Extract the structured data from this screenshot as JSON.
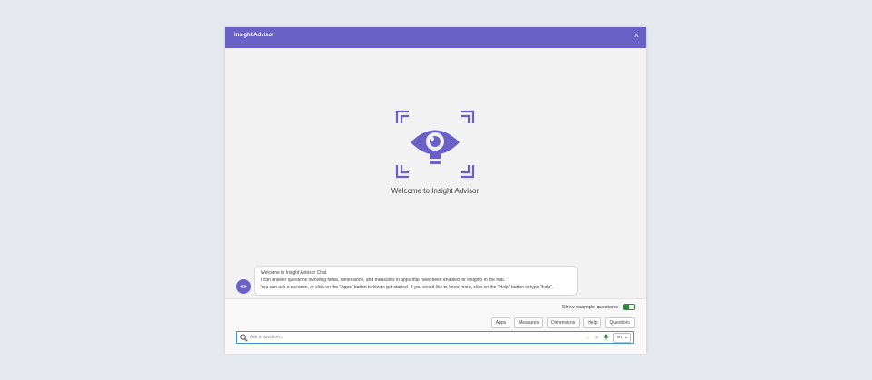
{
  "dialog": {
    "title": "Insight Advisor",
    "close_glyph": "×",
    "accent_color": "#6a60c5",
    "hero_icon": "eye-lightbulb-icon",
    "welcome_title": "Welcome to Insight Advisor"
  },
  "chat": {
    "avatar_icon": "insight-advisor-eye-icon",
    "message_lines": [
      "Welcome to Insight Advisor Chat.",
      "I can answer questions involving fields, dimensions, and measures in apps that have been enabled for insights in the hub.",
      "You can ask a question, or click on the \"Apps\" button below to get started. If you would like to know more, click on the \"Help\" button or type \"help\"."
    ]
  },
  "footer": {
    "show_examples_label": "Show example questions",
    "show_examples_on": true,
    "toggle_color": "#2e8b3d",
    "chips": [
      "Apps",
      "Measures",
      "Dimensions",
      "Help",
      "Questions"
    ],
    "search": {
      "placeholder": "Ask a question...",
      "value": "",
      "send_glyph": "→",
      "clear_glyph": "✕",
      "mic_icon": "microphone-icon",
      "language": "en",
      "language_chevron": "⌄"
    }
  }
}
